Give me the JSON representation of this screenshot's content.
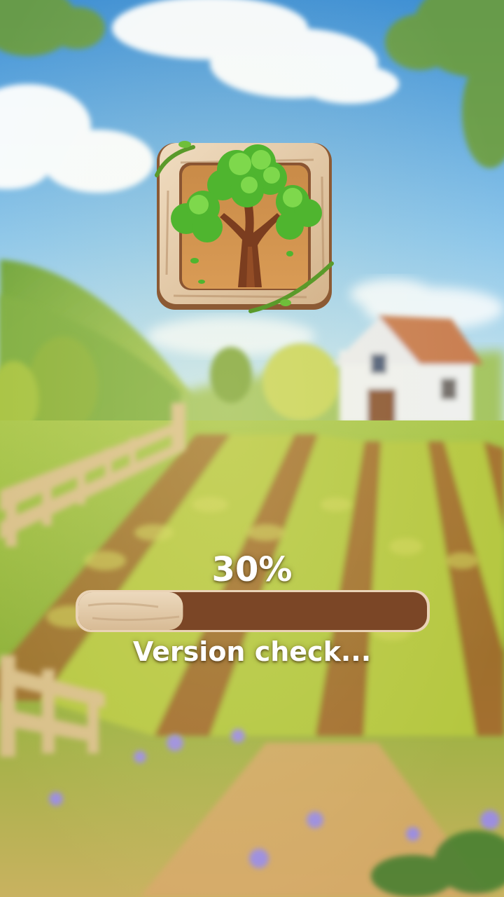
{
  "loading": {
    "percent_label": "30%",
    "progress": 0.3,
    "status_text": "Version check..."
  },
  "colors": {
    "sky_top": "#4f9fd8",
    "sky_bottom": "#cde8f2",
    "grass": "#8fb83a",
    "crop": "#b5c73e",
    "soil": "#a25c2a",
    "wood_light": "#e2c9a6",
    "wood_dark": "#7a4526",
    "progress_track": "#7b4626",
    "leaf_green": "#57c437",
    "trunk": "#7b3d1f"
  },
  "icons": {
    "app_logo": "tree-icon"
  }
}
